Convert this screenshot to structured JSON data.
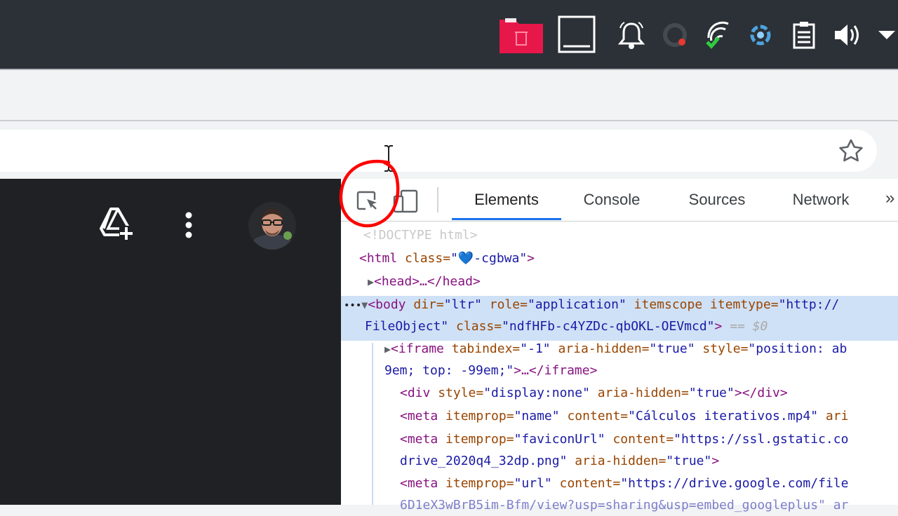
{
  "tray": {
    "icons": [
      "trash-icon",
      "window-icon",
      "bell-icon",
      "update-icon",
      "network-icon",
      "cloud-sync-icon",
      "clipboard-icon",
      "volume-icon",
      "dropdown-arrow-icon"
    ]
  },
  "drive": {
    "add_icon": "drive-add-icon",
    "more_icon": "more-vert-icon"
  },
  "devtools": {
    "tabs": [
      "Elements",
      "Console",
      "Sources",
      "Network"
    ],
    "more_tabs": "»",
    "annotation_color": "#ff0000",
    "accent": "#1a73e8",
    "code": {
      "doctype": "<!DOCTYPE html>",
      "html_open": "<html ",
      "html_attr": "class=",
      "html_val": "\"💙-cgbwa\"",
      "html_close": ">",
      "head_line": "<head>…</head>",
      "body_tag": "<body ",
      "body_a1": "dir=",
      "body_v1": "\"ltr\"",
      "body_a2": " role=",
      "body_v2": "\"application\"",
      "body_a3": " itemscope itemtype=",
      "body_v3": "\"http://",
      "body_l2_v": "FileObject\"",
      "body_l2_a": " class=",
      "body_l2_v2": "\"ndfHFb-c4YZDc-qbOKL-OEVmcd\"",
      "body_l2_close": ">",
      "body_eq": " == $0",
      "iframe_tag": "<iframe ",
      "iframe_a1": "tabindex=",
      "iframe_v1": "\"-1\"",
      "iframe_a2": " aria-hidden=",
      "iframe_v2": "\"true\"",
      "iframe_a3": " style=",
      "iframe_v3": "\"position: ab",
      "iframe_l2_v": "9em; top: -99em;\"",
      "iframe_l2_close": ">…</iframe>",
      "div_tag": "<div ",
      "div_a1": "style=",
      "div_v1": "\"display:none\"",
      "div_a2": " aria-hidden=",
      "div_v2": "\"true\"",
      "div_close": "></div>",
      "meta1_tag": "<meta ",
      "meta1_a1": "itemprop=",
      "meta1_v1": "\"name\"",
      "meta1_a2": " content=",
      "meta1_v2": "\"Cálculos iterativos.mp4\"",
      "meta1_a3": " ari",
      "meta2_tag": "<meta ",
      "meta2_a1": "itemprop=",
      "meta2_v1": "\"faviconUrl\"",
      "meta2_a2": " content=",
      "meta2_v2": "\"https://ssl.gstatic.co",
      "meta2_l2_v": "drive_2020q4_32dp.png\"",
      "meta2_l2_a": " aria-hidden=",
      "meta2_l2_v2": "\"true\"",
      "meta2_l2_close": ">",
      "meta3_tag": "<meta ",
      "meta3_a1": "itemprop=",
      "meta3_v1": "\"url\"",
      "meta3_a2": " content=",
      "meta3_v2": "\"https://drive.google.com/file",
      "meta3_l2": "6D1eX3wBrB5im-Bfm/view?usp=sharing&usp=embed_googleplus\" ar"
    }
  }
}
